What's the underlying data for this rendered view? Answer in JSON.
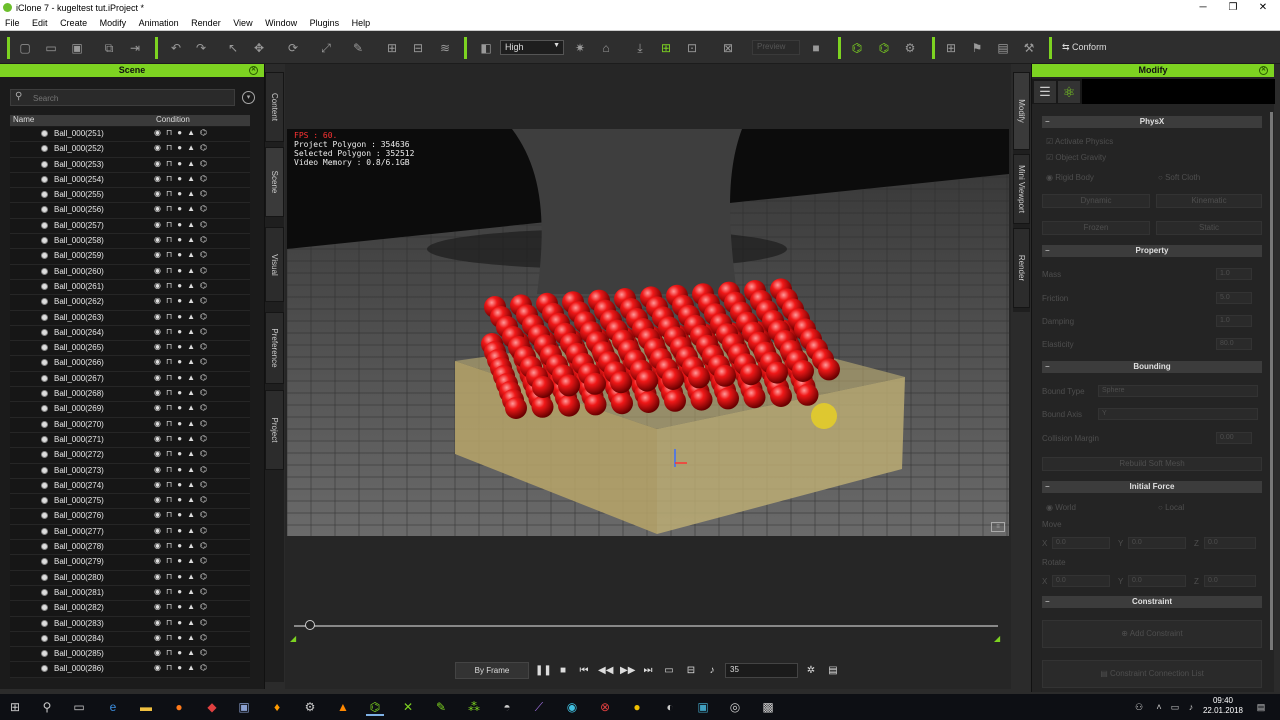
{
  "window": {
    "title": "iClone 7 - kugeltest tut.iProject *",
    "min": "─",
    "max": "❐",
    "close": "✕"
  },
  "menu": [
    "File",
    "Edit",
    "Create",
    "Modify",
    "Animation",
    "Render",
    "View",
    "Window",
    "Plugins",
    "Help"
  ],
  "toolbar": {
    "quality": "High",
    "preview": "Preview",
    "conform": "Conform"
  },
  "scene": {
    "title": "Scene",
    "search_placeholder": "Search",
    "col_name": "Name",
    "col_condition": "Condition",
    "items": [
      "Ball_000(251)",
      "Ball_000(252)",
      "Ball_000(253)",
      "Ball_000(254)",
      "Ball_000(255)",
      "Ball_000(256)",
      "Ball_000(257)",
      "Ball_000(258)",
      "Ball_000(259)",
      "Ball_000(260)",
      "Ball_000(261)",
      "Ball_000(262)",
      "Ball_000(263)",
      "Ball_000(264)",
      "Ball_000(265)",
      "Ball_000(266)",
      "Ball_000(267)",
      "Ball_000(268)",
      "Ball_000(269)",
      "Ball_000(270)",
      "Ball_000(271)",
      "Ball_000(272)",
      "Ball_000(273)",
      "Ball_000(274)",
      "Ball_000(275)",
      "Ball_000(276)",
      "Ball_000(277)",
      "Ball_000(278)",
      "Ball_000(279)",
      "Ball_000(280)",
      "Ball_000(281)",
      "Ball_000(282)",
      "Ball_000(283)",
      "Ball_000(284)",
      "Ball_000(285)",
      "Ball_000(286)"
    ]
  },
  "left_tabs": [
    "Content",
    "Scene",
    "Visual",
    "Preference",
    "Project"
  ],
  "right_tabs": [
    "Modify",
    "Mini Viewport",
    "Render"
  ],
  "viewport": {
    "fps": "FPS : 60.",
    "project_polygon": "Project Polygon : 354636",
    "selected_polygon": "Selected Polygon : 352512",
    "video_memory": "Video Memory : 0.8/6.1GB"
  },
  "playback": {
    "mode": "By Frame",
    "frame": "35"
  },
  "modify": {
    "title": "Modify",
    "physx": {
      "title": "PhysX",
      "activate": "Activate Physics",
      "gravity": "Object Gravity",
      "rigid": "Rigid Body",
      "soft": "Soft Cloth",
      "dynamic": "Dynamic",
      "kinematic": "Kinematic",
      "frozen": "Frozen",
      "static": "Static"
    },
    "property": {
      "title": "Property",
      "mass": "Mass",
      "mass_v": "1.0",
      "friction": "Friction",
      "friction_v": "5.0",
      "damping": "Damping",
      "damping_v": "1.0",
      "elasticity": "Elasticity",
      "elasticity_v": "80.0"
    },
    "bounding": {
      "title": "Bounding",
      "type": "Bound Type",
      "type_v": "Sphere",
      "axis": "Bound Axis",
      "axis_v": "Y",
      "margin": "Collision Margin",
      "margin_v": "0.00",
      "rebuild": "Rebuild Soft Mesh"
    },
    "force": {
      "title": "Initial Force",
      "world": "World",
      "local": "Local",
      "move": "Move",
      "rotate": "Rotate",
      "x": "X",
      "y": "Y",
      "z": "Z",
      "zero": "0.0"
    },
    "constraint": {
      "title": "Constraint",
      "add": "Add Constraint",
      "list": "Constraint Connection List"
    }
  },
  "taskbar": {
    "time": "09:40",
    "date": "22.01.2018"
  }
}
